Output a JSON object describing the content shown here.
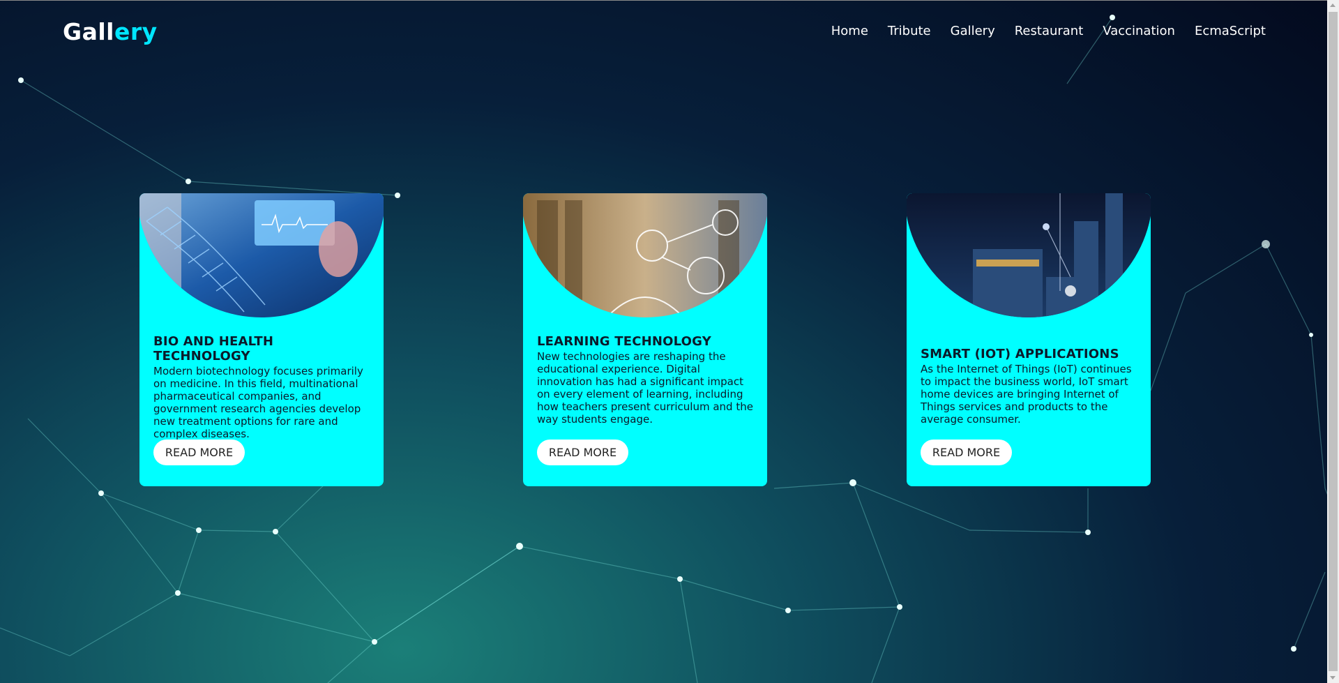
{
  "header": {
    "logo_main": "Gall",
    "logo_accent": "ery",
    "nav": [
      "Home",
      "Tribute",
      "Gallery",
      "Restaurant",
      "Vaccination",
      "EcmaScript"
    ]
  },
  "cards": [
    {
      "title": "BIO AND HEALTH TECHNOLOGY",
      "text": "Modern biotechnology focuses primarily on medicine. In this field, multinational pharmaceutical companies, and government research agencies develop new treatment options for rare and complex diseases.",
      "button": "READ MORE"
    },
    {
      "title": "LEARNING TECHNOLOGY",
      "text": "New technologies are reshaping the educational experience. Digital innovation has had a significant impact on every element of learning, including how teachers present curriculum and the way students engage.",
      "button": "READ MORE"
    },
    {
      "title": "SMART (IOT) APPLICATIONS",
      "text": "As the Internet of Things (IoT) continues to impact the business world, IoT smart home devices are bringing Internet of Things services and products to the average consumer.",
      "button": "READ MORE"
    }
  ],
  "colors": {
    "card": "#00ffff",
    "accent": "#00e6ff"
  }
}
